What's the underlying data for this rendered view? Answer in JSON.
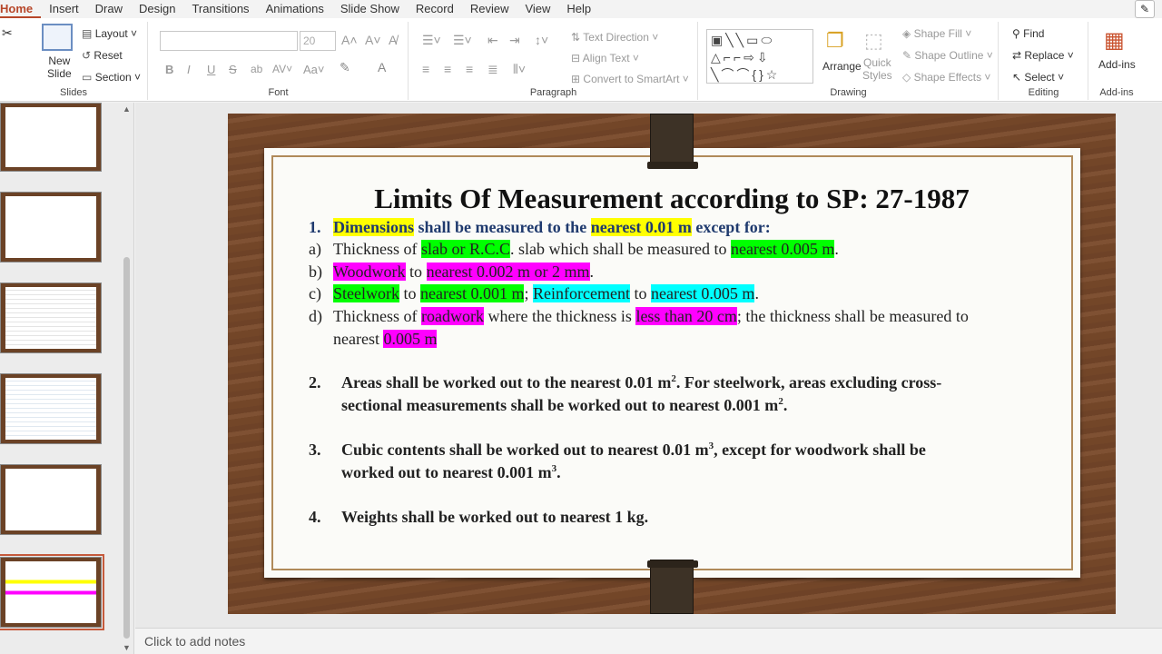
{
  "tabs": [
    {
      "label": "Home",
      "active": true
    },
    {
      "label": "Insert"
    },
    {
      "label": "Draw"
    },
    {
      "label": "Design"
    },
    {
      "label": "Transitions"
    },
    {
      "label": "Animations"
    },
    {
      "label": "Slide Show"
    },
    {
      "label": "Record"
    },
    {
      "label": "Review"
    },
    {
      "label": "View"
    },
    {
      "label": "Help"
    }
  ],
  "ribbon": {
    "slides": {
      "group": "Slides",
      "new_slide": "New\nSlide",
      "layout": "Layout",
      "reset": "Reset",
      "section": "Section"
    },
    "font": {
      "group": "Font",
      "font_size": "20"
    },
    "paragraph": {
      "group": "Paragraph",
      "text_direction": "Text Direction",
      "align_text": "Align Text",
      "smartart": "Convert to SmartArt"
    },
    "drawing": {
      "group": "Drawing",
      "arrange": "Arrange",
      "quick_styles": "Quick\nStyles",
      "shape_fill": "Shape Fill",
      "shape_outline": "Shape Outline",
      "shape_effects": "Shape Effects"
    },
    "editing": {
      "group": "Editing",
      "find": "Find",
      "replace": "Replace",
      "select": "Select"
    },
    "addins": {
      "group": "Add-ins",
      "addins": "Add-ins"
    }
  },
  "slide": {
    "title": "Limits Of Measurement according to SP: 27-1987",
    "item1": {
      "num": "1.",
      "t1": "Dimensions",
      "t2": " shall be measured to the ",
      "t3": "nearest 0.01 m",
      "t4": " except for:"
    },
    "a": {
      "label": "a)",
      "t1": "Thickness of ",
      "t2": "slab or R.C.C",
      "t3": ". slab which shall be measured to ",
      "t4": "nearest 0.005 m",
      "t5": "."
    },
    "b": {
      "label": "b)",
      "t1": "Woodwork",
      "t2": " to ",
      "t3": "nearest 0.002 m or 2 mm",
      "t4": "."
    },
    "c": {
      "label": "c)",
      "t1": "Steelwork",
      "t2": " to ",
      "t3": "nearest 0.001 m",
      "t4": "; ",
      "t5": "Reinforcement",
      "t6": " to ",
      "t7": "nearest 0.005 m",
      "t8": "."
    },
    "d": {
      "label": "d)",
      "t1": "Thickness of ",
      "t2": "roadwork",
      "t3": " where the thickness is ",
      "t4": "less than 20 cm",
      "t5": "; the thickness shall be measured to",
      "t6": "nearest ",
      "t7": "0.005 m"
    },
    "item2": {
      "num": "2.",
      "line1": "Areas shall be worked out to the nearest 0.01 m",
      "sup1": "2",
      "line1b": ". For steelwork, areas excluding cross-",
      "line2": "sectional measurements shall be worked out to nearest 0.001 m",
      "sup2": "2",
      "line2b": "."
    },
    "item3": {
      "num": "3.",
      "line1": "Cubic contents shall be worked out to nearest 0.01 m",
      "sup1": "3",
      "line1b": ", except for woodwork shall be",
      "line2": "worked out to nearest 0.001 m",
      "sup2": "3",
      "line2b": "."
    },
    "item4": {
      "num": "4.",
      "line1": "Weights shall be worked out to nearest 1 kg."
    }
  },
  "notes": {
    "placeholder": "Click to add notes"
  },
  "colors": {
    "accent": "#b7472a",
    "highlight_yellow": "#ffff00",
    "highlight_green": "#00ff00",
    "highlight_magenta": "#ff00ff",
    "highlight_cyan": "#00ffff"
  }
}
